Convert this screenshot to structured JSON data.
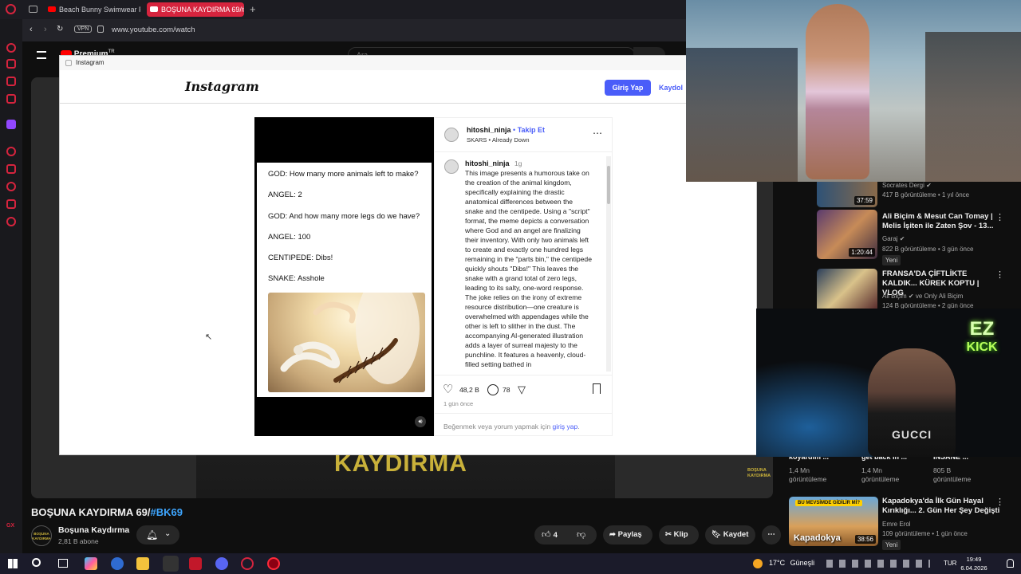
{
  "browser": {
    "tabs": [
      {
        "label": "Beach Bunny Swimwear Fa",
        "active": false
      },
      {
        "label": "BOŞUNA KAYDIRMA 69/#",
        "active": true
      }
    ],
    "vpn_badge": "VPN",
    "url": "www.youtube.com/watch"
  },
  "youtube": {
    "logo_label": "Premium",
    "logo_sup": "TR",
    "search_placeholder": "Ara",
    "video_overlay_text": "KAYDIRMA",
    "video_corner_logo": "BOŞUNA KAYDIRMA",
    "video_title_prefix": "BOŞUNA KAYDIRMA 69/",
    "video_title_hashtag": "#BK69",
    "channel_name": "Boşuna Kaydırma",
    "channel_avatar_text": "BOŞUNA KAYDIRMA",
    "subscribers": "2,81 B abone",
    "like_count": "4",
    "share_label": "Paylaş",
    "clip_label": "Klip",
    "save_label": "Kaydet",
    "suggestions": [
      {
        "channel": "Socrates Dergi",
        "meta": "417 B görüntüleme • 1 yıl önce",
        "duration": "37:59"
      },
      {
        "title": "Ali Biçim & Mesut Can Tomay | Melis İşiten ile Zaten Şov - 13...",
        "channel": "Garaj",
        "meta": "822 B görüntüleme • 3 gün önce",
        "duration": "1:20:44",
        "badge": "Yeni"
      },
      {
        "title": "FRANSA'DA ÇİFTLİKTE KALDIK... KÜREK KOPTU | VLOG",
        "channel": "Ali Biçim",
        "channel_suffix": "ve Only Ali Biçim",
        "meta": "124 B görüntüleme • 2 gün önce"
      },
      {
        "title": "Kapadokya'da İlk Gün Hayal Kırıklığı... 2. Gün Her Şey Değişti",
        "channel": "Emre Erol",
        "meta": "109 görüntüleme • 1 gün önce",
        "duration": "38:56",
        "badge": "Yeni",
        "thumb_top": "BU MEVSİMDE GİDİLİR Mİ?",
        "thumb_bottom": "Kapadokya"
      }
    ],
    "shorts_row": [
      {
        "title": "koyardım ...",
        "views": "1,4 Mn",
        "views_label": "görüntüleme"
      },
      {
        "title": "get back in ...",
        "views": "1,4 Mn",
        "views_label": "görüntüleme"
      },
      {
        "title": "İNSANE ...",
        "views": "805 B",
        "views_label": "görüntüleme"
      }
    ]
  },
  "instagram_popup": {
    "window_title": "Instagram",
    "logo": "Instagram",
    "login_button": "Giriş Yap",
    "signup_button": "Kaydol",
    "author": "hitoshi_ninja",
    "follow_link": "Takip Et",
    "audio": "SKARS",
    "audio_track": "Already Down",
    "caption_age": "1g",
    "caption": "This image presents a humorous take on the creation of the animal kingdom, specifically explaining the drastic anatomical differences between the snake and the centipede. Using a \"script\" format, the meme depicts a conversation where God and an angel are finalizing their inventory. With only two animals left to create and exactly one hundred legs remaining in the \"parts bin,\" the centipede quickly shouts \"Dibs!\" This leaves the snake with a grand total of zero legs, leading to its salty, one-word response. The joke relies on the irony of extreme resource distribution—one creature is overwhelmed with appendages while the other is left to slither in the dust. The accompanying AI-generated illustration adds a layer of surreal majesty to the punchline. It features a heavenly, cloud-filled setting bathed in",
    "likes": "48,2 B",
    "comments": "78",
    "posted": "1 gün önce",
    "prompt_prefix": "Beğenmek veya yorum yapmak için",
    "prompt_link": "giriş yap",
    "prompt_suffix": ".",
    "meme_lines": [
      "GOD: How many more animals left to make?",
      "ANGEL: 2",
      "GOD: And how many more legs do we have?",
      "ANGEL: 100",
      "CENTIPEDE: Dibs!",
      "SNAKE: Asshole"
    ]
  },
  "stream_overlay": {
    "badge_line1": "EZ",
    "badge_line2": "KICK",
    "shirt_text": "GUCCI"
  },
  "taskbar": {
    "weather_temp": "17°C",
    "weather_label": "Güneşli",
    "language": "TUR",
    "time": "19:49",
    "date": "6.04.2026"
  },
  "colors": {
    "opera_red": "#d6243e",
    "youtube_red": "#ff0000",
    "instagram_blue": "#4a5df9",
    "yt_bg": "#0f0f0f"
  }
}
